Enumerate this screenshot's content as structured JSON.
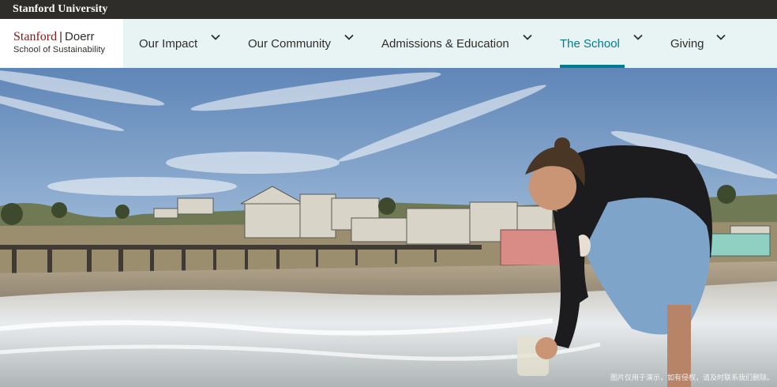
{
  "topbar": {
    "brand": "Stanford University"
  },
  "logo": {
    "stanford": "Stanford",
    "separator": "|",
    "doerr": "Doerr",
    "subtitle": "School of Sustainability"
  },
  "nav": {
    "items": [
      {
        "label": "Our Impact",
        "active": false
      },
      {
        "label": "Our Community",
        "active": false
      },
      {
        "label": "Admissions & Education",
        "active": false
      },
      {
        "label": "The School",
        "active": true
      },
      {
        "label": "Giving",
        "active": false
      }
    ]
  },
  "hero": {
    "caption": "图片仅用于演示，如有侵权，请及时联系我们删除。"
  },
  "colors": {
    "cardinal": "#8c1515",
    "accent": "#017c8c",
    "topbar": "#2e2d29",
    "nav_bg": "#e8f4f4"
  }
}
